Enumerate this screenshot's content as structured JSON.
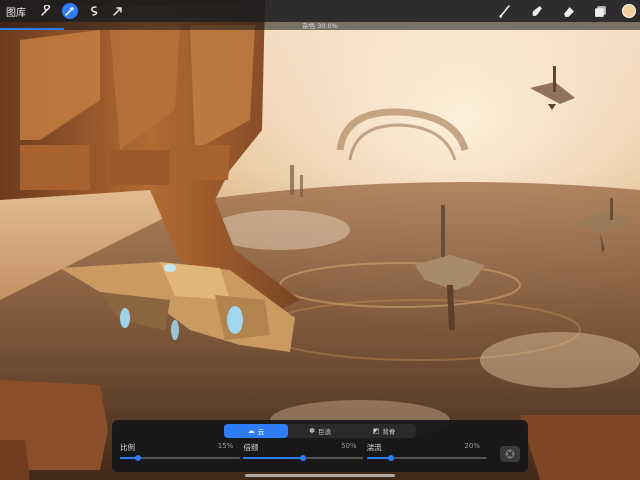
{
  "toolbar": {
    "gallery_label": "图库",
    "left_tools": [
      {
        "icon": "wrench-icon",
        "active": false
      },
      {
        "icon": "magic-wand-icon",
        "active": true
      },
      {
        "icon": "selection-icon",
        "active": false
      },
      {
        "icon": "transform-arrow-icon",
        "active": false
      }
    ],
    "right_tools": [
      "brush-icon",
      "smudge-icon",
      "eraser-icon",
      "layers-icon"
    ],
    "current_color": "#f4cfa0"
  },
  "status": {
    "text": "杂色 30.0%",
    "progress": 0.1
  },
  "panel": {
    "tabs": [
      {
        "label": "云",
        "icon": "cloud-icon",
        "active": true
      },
      {
        "label": "巨浪",
        "icon": "billow-icon",
        "active": false
      },
      {
        "label": "背脊",
        "icon": "ridge-icon",
        "active": false
      }
    ],
    "sliders": [
      {
        "label": "比例",
        "value_text": "15%",
        "value": 0.15
      },
      {
        "label": "倍频",
        "value_text": "50%",
        "value": 0.5
      },
      {
        "label": "湍流",
        "value_text": "20%",
        "value": 0.2
      }
    ]
  },
  "colors": {
    "accent": "#2f7df6",
    "toolbar_bg": "#1c1c1e",
    "panel_bg": "#161618"
  }
}
